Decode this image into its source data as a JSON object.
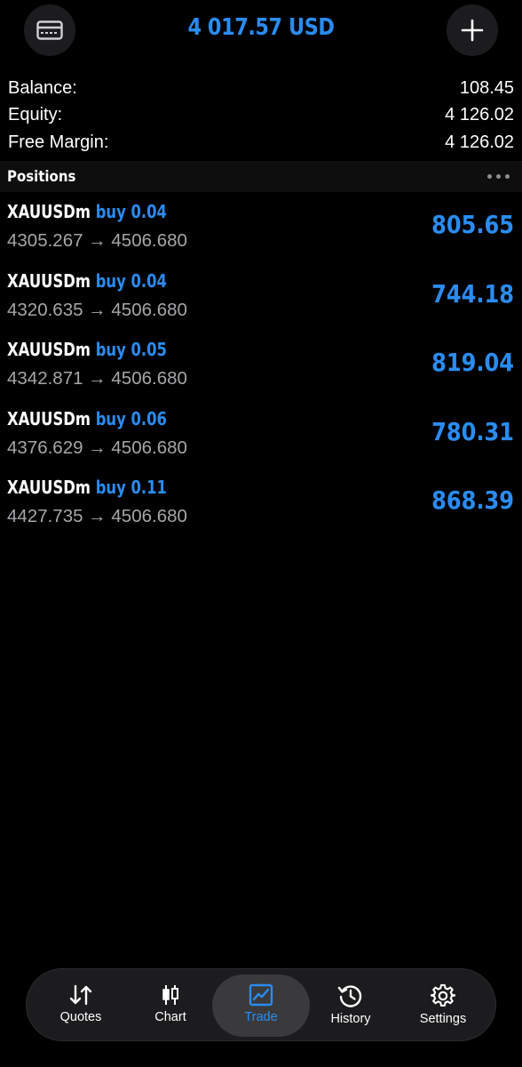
{
  "header": {
    "title": "4 017.57 USD"
  },
  "summary": [
    {
      "label": "Balance:",
      "value": "108.45"
    },
    {
      "label": "Equity:",
      "value": "4 126.02"
    },
    {
      "label": "Free Margin:",
      "value": "4 126.02"
    }
  ],
  "positions_header": {
    "title": "Positions"
  },
  "positions": [
    {
      "symbol": "XAUUSDm",
      "side": "buy 0.04",
      "prices": "4305.267 → 4506.680",
      "profit": "805.65"
    },
    {
      "symbol": "XAUUSDm",
      "side": "buy 0.04",
      "prices": "4320.635 → 4506.680",
      "profit": "744.18"
    },
    {
      "symbol": "XAUUSDm",
      "side": "buy 0.05",
      "prices": "4342.871 → 4506.680",
      "profit": "819.04"
    },
    {
      "symbol": "XAUUSDm",
      "side": "buy 0.06",
      "prices": "4376.629 → 4506.680",
      "profit": "780.31"
    },
    {
      "symbol": "XAUUSDm",
      "side": "buy 0.11",
      "prices": "4427.735 → 4506.680",
      "profit": "868.39"
    }
  ],
  "tabs": [
    {
      "label": "Quotes",
      "icon": "sort-arrows-icon",
      "active": false
    },
    {
      "label": "Chart",
      "icon": "candlestick-icon",
      "active": false
    },
    {
      "label": "Trade",
      "icon": "trend-chart-icon",
      "active": true
    },
    {
      "label": "History",
      "icon": "history-clock-icon",
      "active": false
    },
    {
      "label": "Settings",
      "icon": "gear-icon",
      "active": false
    }
  ],
  "colors": {
    "accent": "#2a8cf0",
    "background": "#000000",
    "muted_text": "#a6a6aa"
  }
}
